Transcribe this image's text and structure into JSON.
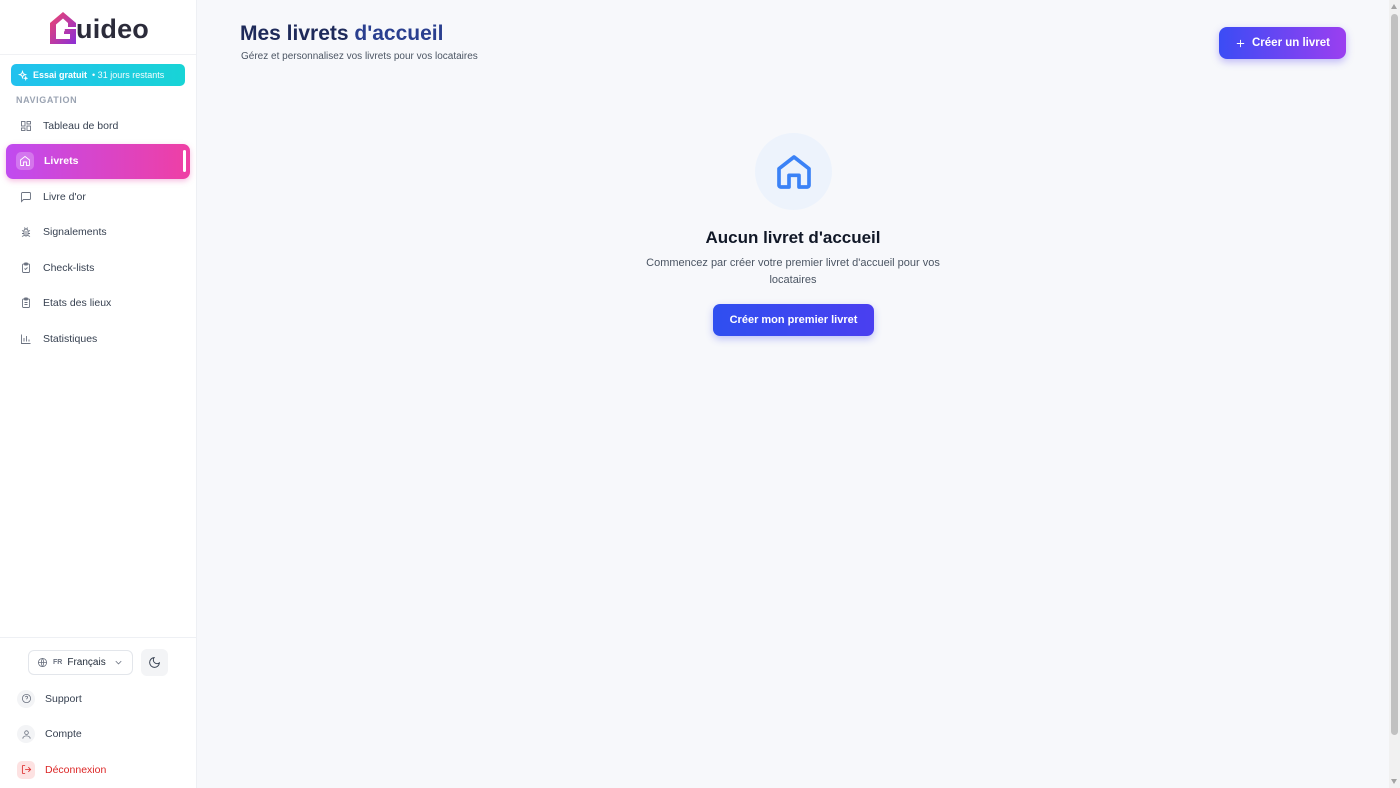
{
  "brand": {
    "name": "uideo",
    "colors": {
      "logo_start": "#ef3f7c",
      "logo_end": "#8b2fd6"
    }
  },
  "trial": {
    "label": "Essai gratuit",
    "remaining": "• 31 jours restants",
    "icon": "sparkle-icon"
  },
  "sidebar": {
    "heading": "NAVIGATION",
    "items": [
      {
        "label": "Tableau de bord",
        "icon": "dashboard-grid-icon",
        "active": false
      },
      {
        "label": "Livrets",
        "icon": "home-icon",
        "active": true
      },
      {
        "label": "Livre d'or",
        "icon": "message-square-icon",
        "active": false
      },
      {
        "label": "Signalements",
        "icon": "bug-icon",
        "active": false
      },
      {
        "label": "Check-lists",
        "icon": "clipboard-check-icon",
        "active": false
      },
      {
        "label": "Etats des lieux",
        "icon": "clipboard-list-icon",
        "active": false
      },
      {
        "label": "Statistiques",
        "icon": "bar-chart-icon",
        "active": false
      }
    ],
    "language": {
      "code": "FR",
      "label": "Français"
    },
    "bottom_items": [
      {
        "label": "Support",
        "icon": "help-circle-icon"
      },
      {
        "label": "Compte",
        "icon": "user-icon"
      },
      {
        "label": "Déconnexion",
        "icon": "logout-icon"
      }
    ]
  },
  "header": {
    "title_main": "Mes livrets",
    "title_accent": "d'accueil",
    "subtitle": "Gérez et personnalisez vos livrets pour vos locataires",
    "create_button": "Créer un livret"
  },
  "empty_state": {
    "icon": "home-icon",
    "title": "Aucun livret d'accueil",
    "description": "Commencez par créer votre premier livret d'accueil pour vos locataires",
    "button": "Créer mon premier livret"
  },
  "colors": {
    "active_nav_start": "#c04bf0",
    "active_nav_end": "#ef3fa4",
    "primary_start": "#3b4cf5",
    "primary_end": "#9b3ff0",
    "trial": "#22c1ee",
    "danger": "#dc2626"
  }
}
